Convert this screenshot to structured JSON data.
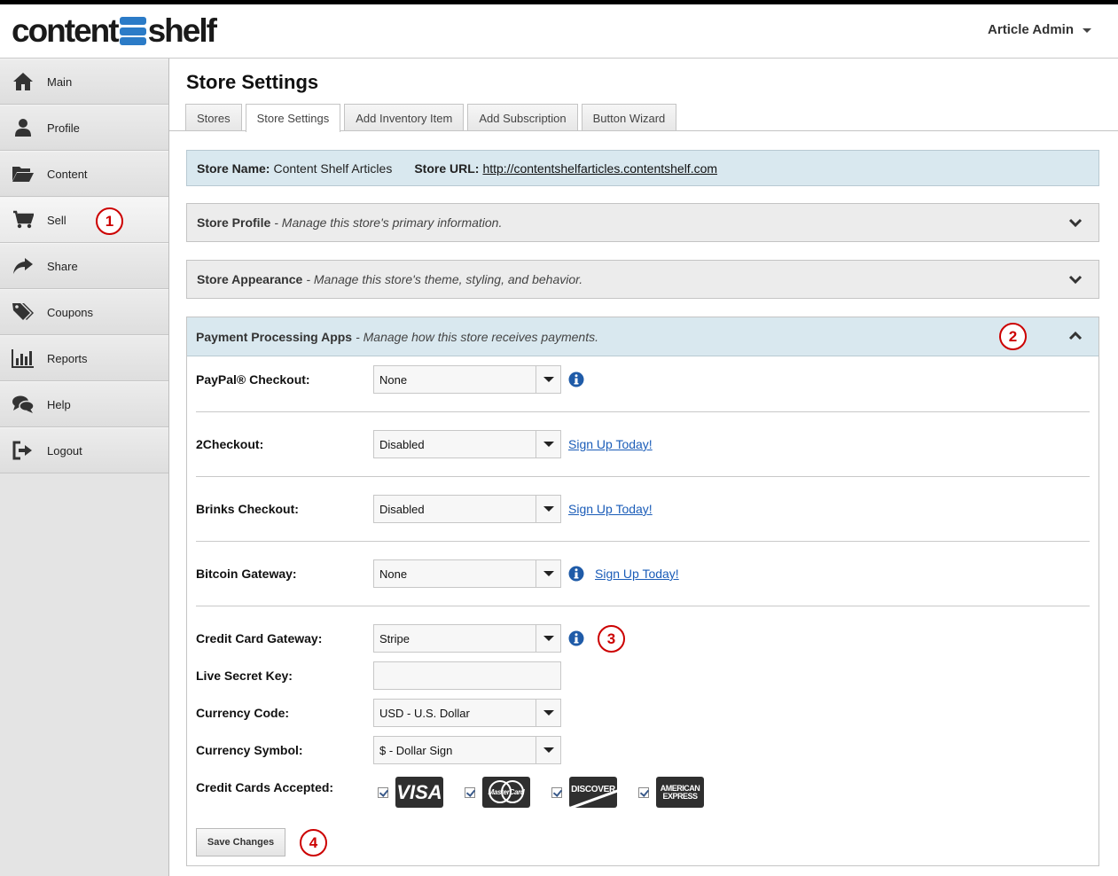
{
  "header": {
    "logo_part1": "content",
    "logo_part2": "shelf",
    "user_menu": "Article Admin"
  },
  "sidebar": {
    "items": [
      {
        "label": "Main",
        "icon": "home-icon"
      },
      {
        "label": "Profile",
        "icon": "user-icon"
      },
      {
        "label": "Content",
        "icon": "folder-icon"
      },
      {
        "label": "Sell",
        "icon": "cart-icon"
      },
      {
        "label": "Share",
        "icon": "share-icon"
      },
      {
        "label": "Coupons",
        "icon": "tags-icon"
      },
      {
        "label": "Reports",
        "icon": "bar-chart-icon"
      },
      {
        "label": "Help",
        "icon": "chat-icon"
      },
      {
        "label": "Logout",
        "icon": "logout-icon"
      }
    ]
  },
  "callouts": [
    "1",
    "2",
    "3",
    "4"
  ],
  "page": {
    "title": "Store Settings",
    "tabs": [
      "Stores",
      "Store Settings",
      "Add Inventory Item",
      "Add Subscription",
      "Button Wizard"
    ]
  },
  "store_info": {
    "name_label": "Store Name:",
    "name_value": "Content Shelf Articles",
    "url_label": "Store URL:",
    "url_value": "http://contentshelfarticles.contentshelf.com"
  },
  "panels": {
    "profile": {
      "title": "Store Profile",
      "desc": "- Manage this store's primary information."
    },
    "appearance": {
      "title": "Store Appearance",
      "desc": "- Manage this store's theme, styling, and behavior."
    },
    "payment": {
      "title": "Payment Processing Apps",
      "desc": "- Manage how this store receives payments."
    }
  },
  "payment_form": {
    "paypal": {
      "label": "PayPal® Checkout:",
      "value": "None"
    },
    "twocheckout": {
      "label": "2Checkout:",
      "value": "Disabled",
      "link": "Sign Up Today!"
    },
    "brinks": {
      "label": "Brinks Checkout:",
      "value": "Disabled",
      "link": "Sign Up Today!"
    },
    "bitcoin": {
      "label": "Bitcoin Gateway:",
      "value": "None",
      "link": "Sign Up Today!"
    },
    "cc_gateway": {
      "label": "Credit Card Gateway:",
      "value": "Stripe"
    },
    "secret_key": {
      "label": "Live Secret Key:",
      "value": ""
    },
    "currency_code": {
      "label": "Currency Code:",
      "value": "USD - U.S. Dollar"
    },
    "currency_symbol": {
      "label": "Currency Symbol:",
      "value": "$ - Dollar Sign"
    },
    "cards": {
      "label": "Credit Cards Accepted:",
      "visa": "VISA",
      "mastercard": "MasterCard",
      "discover": "DISCOVER",
      "amex": "AMERICAN EXPRESS"
    },
    "save_label": "Save Changes"
  },
  "colors": {
    "logo_blue": "#2b7bc7",
    "panel_highlight": "#d9e8ef",
    "callout_red": "#cc0000",
    "link_blue": "#1a5cb8",
    "info_icon_blue": "#1f5ba8"
  }
}
